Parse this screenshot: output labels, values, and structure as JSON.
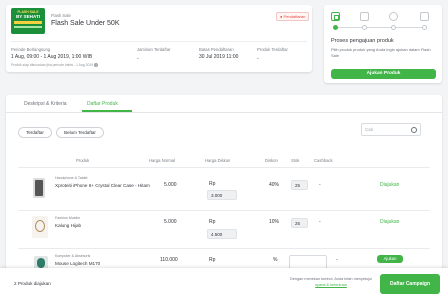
{
  "campaign": {
    "logo_line1": "FLASH SALE",
    "logo_line2": "BY SEHATI",
    "type_label": "Flash Sale",
    "name": "Flash Sale Under 50K",
    "status_badge": "Pendaftaran"
  },
  "info": {
    "period_label": "Periode Berlangsung",
    "period_value": "1 Aug, 09:00 - 1 Aug 2019, 1:00 WIB",
    "period_note": "Produk siap diturunkan jika periode habis - 1 Aug 2019",
    "selected_label": "Jaminan Terdaftar",
    "selected_value": "-",
    "deadline_label": "Batas Pendaftaran",
    "deadline_value": "30 Jul 2019 11:00",
    "products_label": "Produk Terdaftar",
    "products_value": "-"
  },
  "steps": {
    "title": "Proses pengajuan produk",
    "desc": "Pilih produk produk yang Anda ingin ajukan dalam Flash Sale",
    "button": "Ajukan Produk"
  },
  "tabs": [
    "Deskripsi & Kriteria",
    "Daftar Produk"
  ],
  "filters": {
    "registered": "Terdaftar",
    "not_registered": "Belum Terdaftar",
    "search_placeholder": "Cari"
  },
  "table": {
    "headers": [
      "Produk",
      "Harga Normal",
      "Harga Diskon",
      "Diskon",
      "Stok",
      "Cashback",
      ""
    ],
    "rows": [
      {
        "category": "Handphone & Tablet",
        "name": "Xproteiti iPhone 6+ Crystal Clear Case - Hitam",
        "normal_price": "5.000",
        "currency": "Rp",
        "discount_price": "3.000",
        "discount": "40%",
        "stock": "25",
        "cashback": "-",
        "action": "Diajukan"
      },
      {
        "category": "Fashion Muslim",
        "name": "Kalung Hijab",
        "normal_price": "5.000",
        "currency": "Rp",
        "discount_price": "4.500",
        "discount": "10%",
        "stock": "25",
        "cashback": "-",
        "action": "Diajukan"
      },
      {
        "category": "Komputer & Aksesoris",
        "name": "Mouse Logitech M170",
        "normal_price": "110.000",
        "currency": "Rp",
        "discount_price": "",
        "discount": "%",
        "stock": "",
        "cashback": "-",
        "action": "Ajukan"
      }
    ]
  },
  "footer": {
    "count_text": "2 Produk diajukan",
    "terms_prefix": "Dengan menekan tombol, Anda telah menyetujui",
    "terms_link": "syarat & ketentuan",
    "button": "Daftar Campaign"
  },
  "colors": {
    "accent": "#42b549",
    "badge": "#e5463b"
  }
}
